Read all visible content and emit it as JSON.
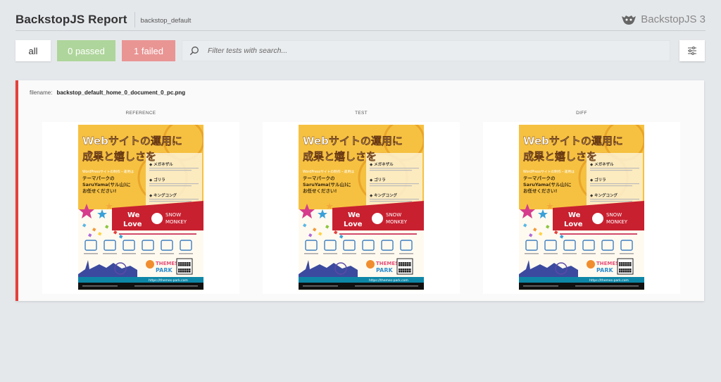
{
  "header": {
    "title": "BackstopJS Report",
    "subtitle": "backstop_default",
    "brand": "BackstopJS 3"
  },
  "toolbar": {
    "all_label": "all",
    "passed_label": "0 passed",
    "failed_label": "1 failed",
    "search_placeholder": "Filter tests with search..."
  },
  "test": {
    "filename_label": "filename:",
    "filename": "backstop_default_home_0_document_0_pc.png",
    "status": "failed",
    "columns": [
      "REFERENCE",
      "TEST",
      "DIFF"
    ]
  },
  "flyer": {
    "headline_line1": "Webサイトの運用に",
    "headline_line2": "成果と嬉しさを",
    "plans": [
      "メガネザル",
      "ゴリラ",
      "キングコング"
    ],
    "lead_small": "WordPressサイトの制作・運用は",
    "lead_big": [
      "テーマパークの",
      "SaruYama(サル山)に",
      "お任せください!"
    ],
    "banner_we": "We",
    "banner_love": "Love",
    "banner_snow": "SNOW",
    "banner_monkey": "MONKEY",
    "park_themes": "THEMES",
    "park_park": "PARK",
    "url": "https://themes-park.com"
  },
  "colors": {
    "accent_fail": "#e5403b",
    "passed_bg": "#aed59b",
    "failed_bg": "#e99594",
    "flyer_yellow": "#f6c141",
    "flyer_red": "#c8202f"
  },
  "icons": {
    "brand": "monkey-logo-icon",
    "search": "search-icon",
    "settings": "sliders-icon"
  }
}
